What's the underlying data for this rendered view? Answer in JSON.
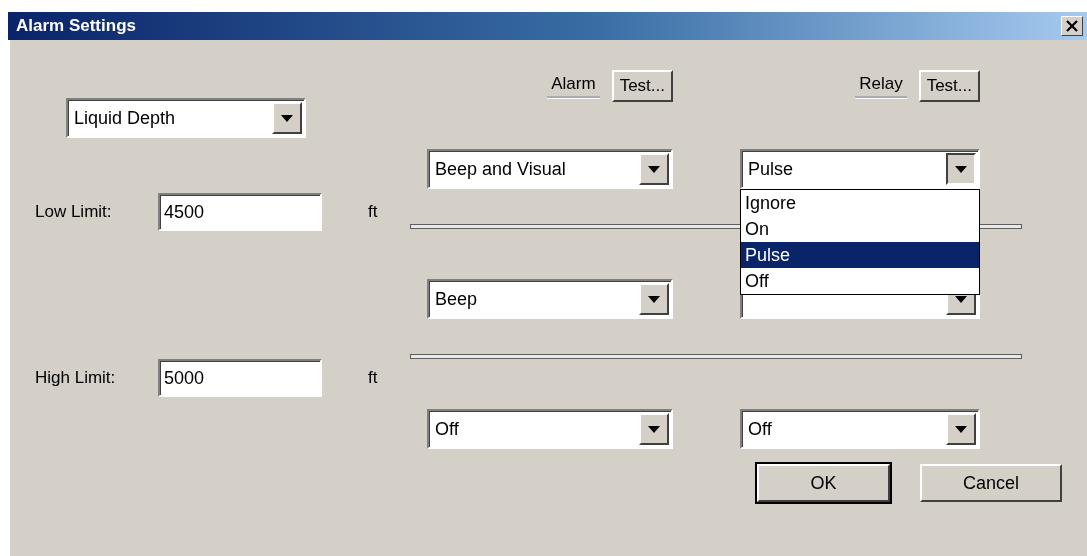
{
  "window": {
    "title": "Alarm Settings"
  },
  "measurement": {
    "value": "Liquid Depth"
  },
  "limits": [
    {
      "label": "Low Limit:",
      "value": "4500",
      "unit": "ft"
    },
    {
      "label": "High Limit:",
      "value": "5000",
      "unit": "ft"
    }
  ],
  "columns": [
    {
      "label": "Alarm",
      "test_button": "Test..."
    },
    {
      "label": "Relay",
      "test_button": "Test..."
    }
  ],
  "rows": [
    {
      "alarm": {
        "value": "Beep and Visual"
      },
      "relay": {
        "value": "Pulse",
        "expanded": true,
        "options": [
          {
            "label": "Ignore",
            "selected": false
          },
          {
            "label": "On",
            "selected": false
          },
          {
            "label": "Pulse",
            "selected": true
          },
          {
            "label": "Off",
            "selected": false
          }
        ]
      }
    },
    {
      "alarm": {
        "value": "Beep"
      },
      "relay": {
        "expanded": false
      }
    },
    {
      "alarm": {
        "value": "Off"
      },
      "relay": {
        "value": "Off",
        "expanded": false
      }
    }
  ],
  "buttons": [
    {
      "label": "OK",
      "default": true
    },
    {
      "label": "Cancel",
      "default": false
    }
  ]
}
